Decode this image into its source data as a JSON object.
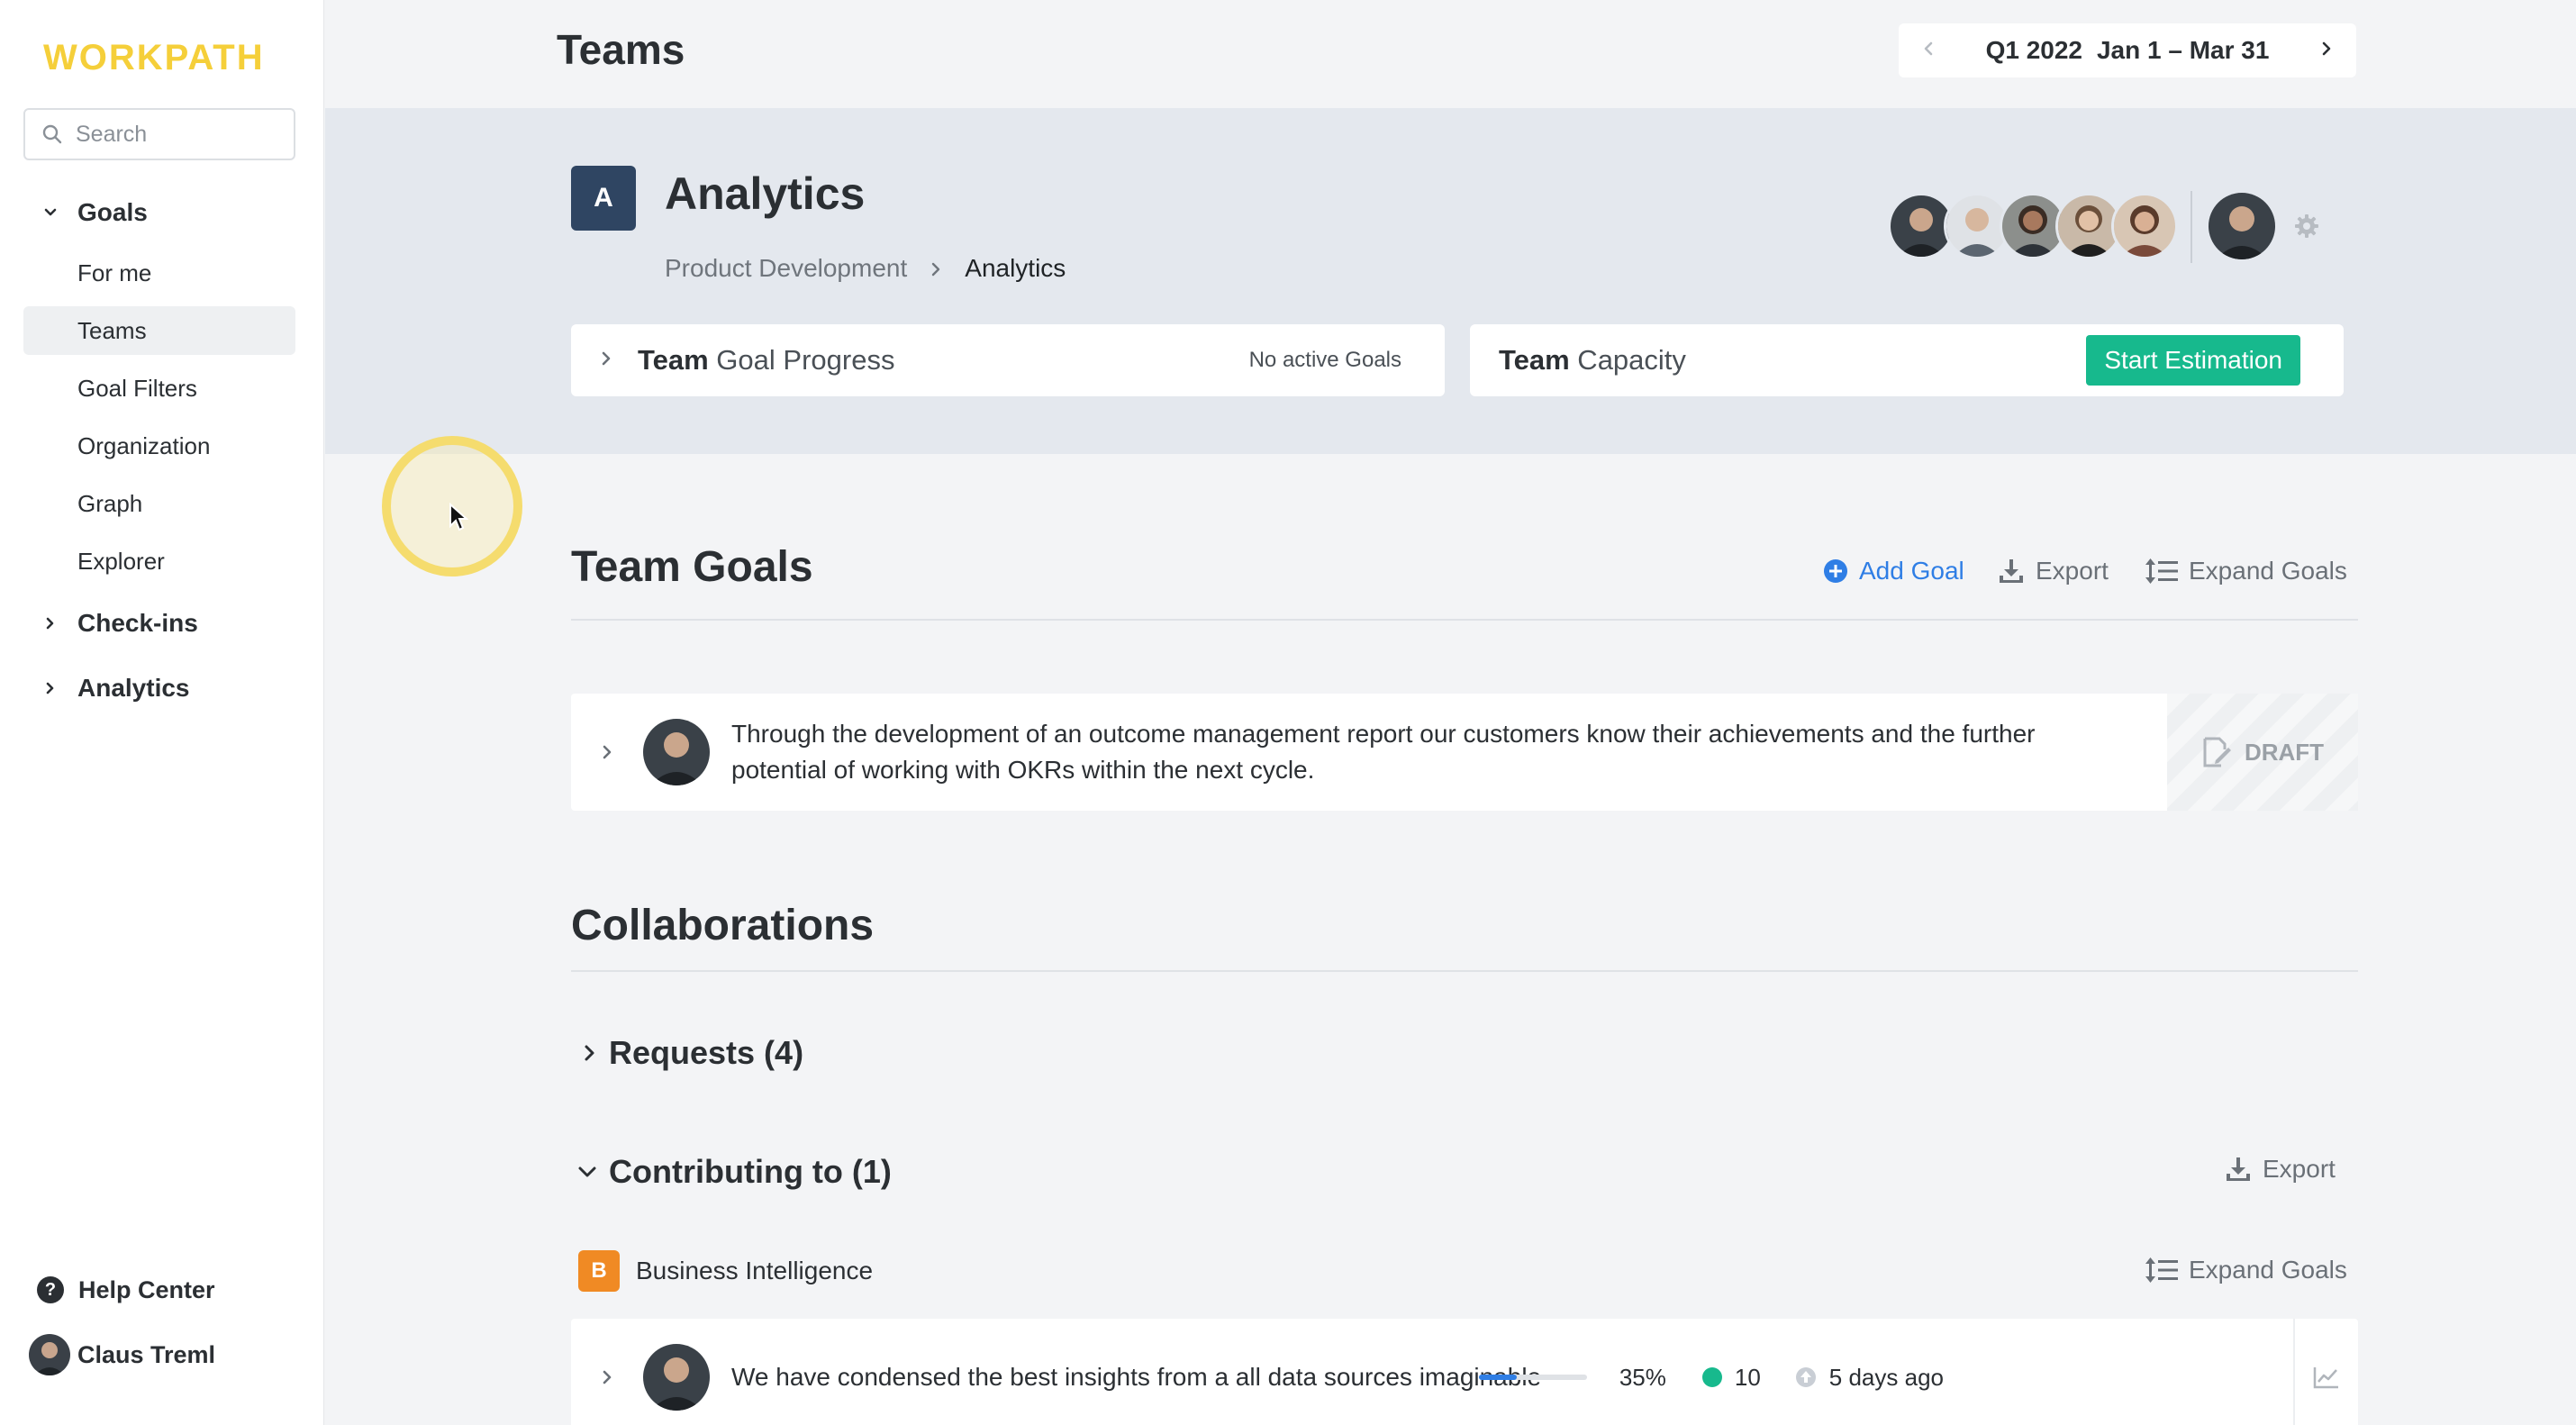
{
  "app": {
    "logo": "WORKPATH"
  },
  "sidebar": {
    "search_placeholder": "Search",
    "sections": [
      {
        "label": "Goals",
        "expanded": true
      },
      {
        "label": "Check-ins",
        "expanded": false
      },
      {
        "label": "Analytics",
        "expanded": false
      }
    ],
    "goal_items": [
      "For me",
      "Teams",
      "Goal Filters",
      "Organization",
      "Graph",
      "Explorer"
    ],
    "active_item": "Teams",
    "help": "Help Center",
    "user": "Claus Treml"
  },
  "header": {
    "title": "Teams",
    "period": {
      "quarter": "Q1 2022",
      "range": "Jan 1 – Mar 31"
    }
  },
  "team": {
    "badge": "A",
    "name": "Analytics",
    "breadcrumb": {
      "parent": "Product Development",
      "current": "Analytics"
    },
    "progress_card": {
      "bold": "Team",
      "rest": " Goal Progress",
      "status": "No active Goals"
    },
    "capacity_card": {
      "bold": "Team",
      "rest": " Capacity",
      "button": "Start Estimation"
    }
  },
  "team_goals": {
    "title": "Team Goals",
    "actions": {
      "add": "Add Goal",
      "export": "Export",
      "expand": "Expand Goals"
    },
    "goals": [
      {
        "text": "Through the development of an outcome management report our customers know their achievements and the further potential of working with OKRs within the next cycle.",
        "status": "DRAFT"
      }
    ]
  },
  "collaborations": {
    "title": "Collaborations",
    "requests": "Requests (4)",
    "contributing": "Contributing to (1)",
    "export": "Export",
    "team": {
      "badge": "B",
      "name": "Business Intelligence",
      "expand": "Expand Goals"
    },
    "goal": {
      "text": "We have condensed the best insights from a all data sources imaginable",
      "progress": 0.35,
      "progress_label": "35%",
      "confidence": "10",
      "updated": "5 days ago"
    }
  },
  "colors": {
    "logo": "#f5cf3a",
    "accent_blue": "#2f7ee5",
    "green": "#17b98d",
    "team_badge": "#2f4562",
    "bi_badge": "#f08a24"
  }
}
